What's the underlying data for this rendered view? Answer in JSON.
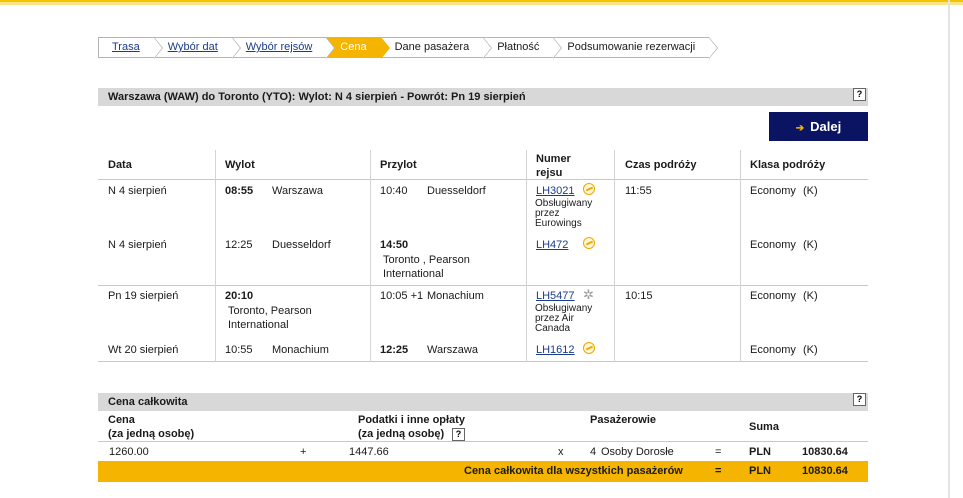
{
  "breadcrumb": [
    {
      "label": "Trasa",
      "link": true
    },
    {
      "label": "Wybór dat",
      "link": true
    },
    {
      "label": "Wybór rejsów",
      "link": true
    },
    {
      "label": "Cena",
      "active": true
    },
    {
      "label": "Dane pasażera"
    },
    {
      "label": "Płatność"
    },
    {
      "label": "Podsumowanie rezerwacji"
    }
  ],
  "itinerary": {
    "title": "Warszawa (WAW) do Toronto (YTO): Wylot: N 4 sierpień  - Powrót: Pn 19 sierpień",
    "help": "?",
    "next_button": "Dalej",
    "columns": [
      "Data",
      "Wylot",
      "Przylot",
      "Numer rejsu",
      "Czas podróży",
      "Klasa podróży"
    ],
    "rows": [
      {
        "date": "N 4 sierpień",
        "dep_time": "08:55",
        "dep_city": "Warszawa",
        "arr_time": "10:40",
        "arr_city": "Duesseldorf",
        "flight": "LH3021",
        "operated": "Obsługiwany przez Eurowings",
        "duration": "11:55",
        "class": "Economy",
        "code": "(K)"
      },
      {
        "date": "N 4 sierpień",
        "dep_time": "12:25",
        "dep_city": "Duesseldorf",
        "arr_time": "14:50",
        "arr_city": "Toronto , Pearson International",
        "flight": "LH472",
        "operated": "",
        "duration": "",
        "class": "Economy",
        "code": "(K)"
      },
      {
        "date": "Pn 19 sierpień",
        "dep_time": "20:10",
        "dep_city": "Toronto, Pearson International",
        "arr_time": "10:05 +1",
        "arr_city": "Monachium",
        "flight": "LH5477",
        "operated": "Obsługiwany przez Air Canada",
        "duration": "10:15",
        "class": "Economy",
        "code": "(K)"
      },
      {
        "date": "Wt 20 sierpień",
        "dep_time": "10:55",
        "dep_city": "Monachium",
        "arr_time": "12:25",
        "arr_city": "Warszawa",
        "flight": "LH1612",
        "operated": "",
        "duration": "",
        "class": "Economy",
        "code": "(K)"
      }
    ]
  },
  "price": {
    "title": "Cena całkowita",
    "help": "?",
    "col_price": "Cena",
    "col_price_sub": "(za jedną osobę)",
    "col_tax": "Podatki i inne opłaty",
    "col_tax_sub": "(za jedną osobę)",
    "col_pax": "Pasażerowie",
    "col_sum": "Suma",
    "fare": "1260.00",
    "plus": "+",
    "tax": "1447.66",
    "times": "x",
    "pax_count": "4",
    "pax_type": "Osoby Dorosłe",
    "eq": "=",
    "currency": "PLN",
    "subtotal": "10830.64",
    "total_label": "Cena całkowita dla wszystkich pasażerów",
    "total_currency": "PLN",
    "total": "10830.64"
  },
  "colors": {
    "accent": "#f5b400",
    "button": "#0a1463",
    "link": "#1a3c8c"
  }
}
